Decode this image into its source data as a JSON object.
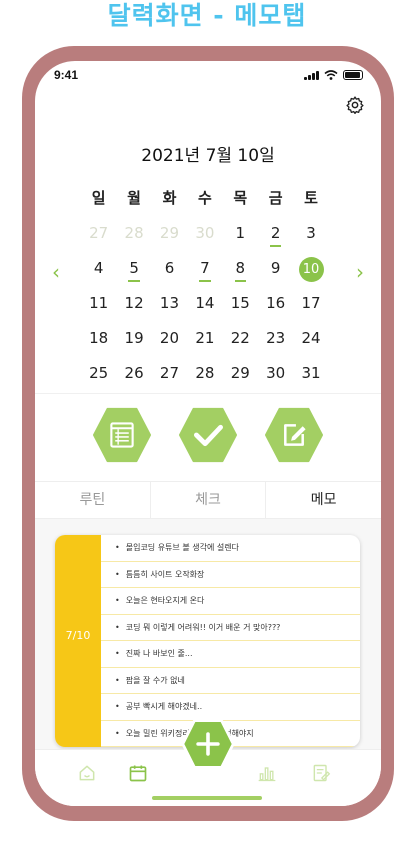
{
  "page_title": "달력화면 - 메모탭",
  "status": {
    "time": "9:41"
  },
  "calendar": {
    "title": "2021년 7월 10일",
    "weekdays": [
      "일",
      "월",
      "화",
      "수",
      "목",
      "금",
      "토"
    ],
    "weeks": [
      [
        "27",
        "28",
        "29",
        "30",
        "1",
        "2",
        "3"
      ],
      [
        "4",
        "5",
        "6",
        "7",
        "8",
        "9",
        "10"
      ],
      [
        "11",
        "12",
        "13",
        "14",
        "15",
        "16",
        "17"
      ],
      [
        "18",
        "19",
        "20",
        "21",
        "22",
        "23",
        "24"
      ],
      [
        "25",
        "26",
        "27",
        "28",
        "29",
        "30",
        "31"
      ]
    ],
    "faded_days": [
      "27",
      "28",
      "29",
      "30"
    ],
    "marked_days": [
      "2",
      "5",
      "7",
      "8"
    ],
    "today": "10"
  },
  "tabs": [
    "루틴",
    "체크",
    "메모"
  ],
  "active_tab": "메모",
  "memo": {
    "date": "7/10",
    "items": [
      "몰입코딩 유튜브 볼 생각에 설렌다",
      "틈틈히 사이트 오작화장",
      "오늘은 현타오지게 온다",
      "코딩 뭐 이렇게 어려워!! 이거 배운 거 맞아???",
      "진짜 나 바보인 줄...",
      "팜을 잘 수가 없네",
      "공부 빡시게 해야겠네..",
      "오늘 밀린 위키정리 블로그 작성해야지"
    ]
  },
  "colors": {
    "accent_green": "#8bc34a",
    "memo_yellow": "#f6c717",
    "title_blue": "#4fc4ee",
    "frame": "#b97d7d"
  },
  "icons": [
    "gear-icon",
    "routine-icon",
    "check-icon",
    "memo-edit-icon",
    "home-icon",
    "calendar-icon",
    "chart-icon",
    "note-icon",
    "plus-icon"
  ]
}
